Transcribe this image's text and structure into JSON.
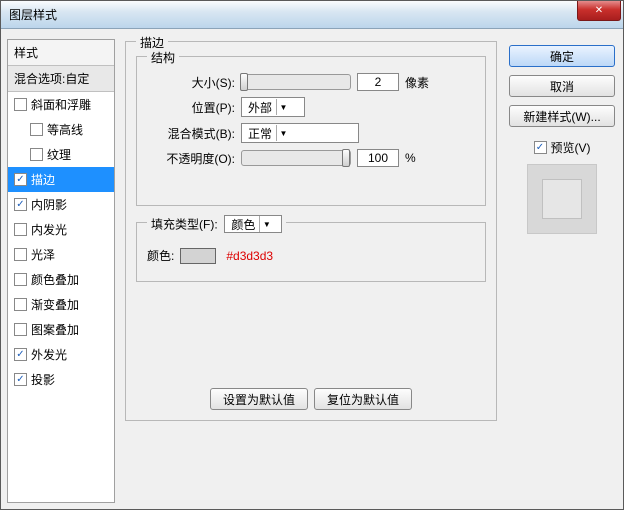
{
  "title": "图层样式",
  "sidebar": {
    "head": "样式",
    "sub": "混合选项:自定",
    "items": [
      {
        "label": "斜面和浮雕",
        "checked": false,
        "selected": false,
        "indent": 0
      },
      {
        "label": "等高线",
        "checked": false,
        "selected": false,
        "indent": 1
      },
      {
        "label": "纹理",
        "checked": false,
        "selected": false,
        "indent": 1
      },
      {
        "label": "描边",
        "checked": true,
        "selected": true,
        "indent": 0
      },
      {
        "label": "内阴影",
        "checked": true,
        "selected": false,
        "indent": 0
      },
      {
        "label": "内发光",
        "checked": false,
        "selected": false,
        "indent": 0
      },
      {
        "label": "光泽",
        "checked": false,
        "selected": false,
        "indent": 0
      },
      {
        "label": "颜色叠加",
        "checked": false,
        "selected": false,
        "indent": 0
      },
      {
        "label": "渐变叠加",
        "checked": false,
        "selected": false,
        "indent": 0
      },
      {
        "label": "图案叠加",
        "checked": false,
        "selected": false,
        "indent": 0
      },
      {
        "label": "外发光",
        "checked": true,
        "selected": false,
        "indent": 0
      },
      {
        "label": "投影",
        "checked": true,
        "selected": false,
        "indent": 0
      }
    ]
  },
  "stroke": {
    "groupLabel": "描边",
    "structLabel": "结构",
    "sizeLabel": "大小(S):",
    "sizeValue": "2",
    "sizeUnit": "像素",
    "posLabel": "位置(P):",
    "posValue": "外部",
    "blendLabel": "混合模式(B):",
    "blendValue": "正常",
    "opacityLabel": "不透明度(O):",
    "opacityValue": "100",
    "opacityUnit": "%",
    "fillGroupLabel": "填充类型(F):",
    "fillValue": "颜色",
    "colorLabel": "颜色:",
    "colorHex": "#d3d3d3",
    "btnDefault": "设置为默认值",
    "btnReset": "复位为默认值"
  },
  "right": {
    "ok": "确定",
    "cancel": "取消",
    "newStyle": "新建样式(W)...",
    "preview": "预览(V)"
  }
}
